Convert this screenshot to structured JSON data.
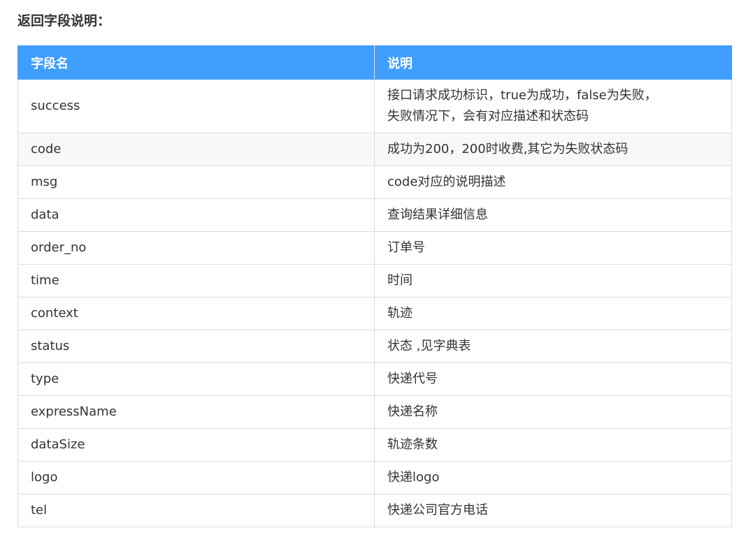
{
  "page": {
    "title": "返回字段说明："
  },
  "table": {
    "header": {
      "field": "字段名",
      "description": "说明"
    },
    "header_color": "#409eff",
    "rows": [
      {
        "field": "success",
        "description_lines": [
          "接口请求成功标识，true为成功，false为失败，",
          "失败情况下，会有对应描述和状态码"
        ]
      },
      {
        "field": "code",
        "description_lines": [
          "成功为200，200时收费,其它为失败状态码"
        ]
      },
      {
        "field": "msg",
        "description_lines": [
          "code对应的说明描述"
        ]
      },
      {
        "field": "data",
        "description_lines": [
          "查询结果详细信息"
        ]
      },
      {
        "field": "order_no",
        "description_lines": [
          "订单号"
        ]
      },
      {
        "field": "time",
        "description_lines": [
          "时间"
        ]
      },
      {
        "field": "context",
        "description_lines": [
          "轨迹"
        ]
      },
      {
        "field": "status",
        "description_lines": [
          "状态 ,见字典表"
        ]
      },
      {
        "field": "type",
        "description_lines": [
          "快递代号"
        ]
      },
      {
        "field": "expressName",
        "description_lines": [
          "快递名称"
        ]
      },
      {
        "field": "dataSize",
        "description_lines": [
          "轨迹条数"
        ]
      },
      {
        "field": "logo",
        "description_lines": [
          "快递logo"
        ]
      },
      {
        "field": "tel",
        "description_lines": [
          "快递公司官方电话"
        ]
      }
    ]
  }
}
